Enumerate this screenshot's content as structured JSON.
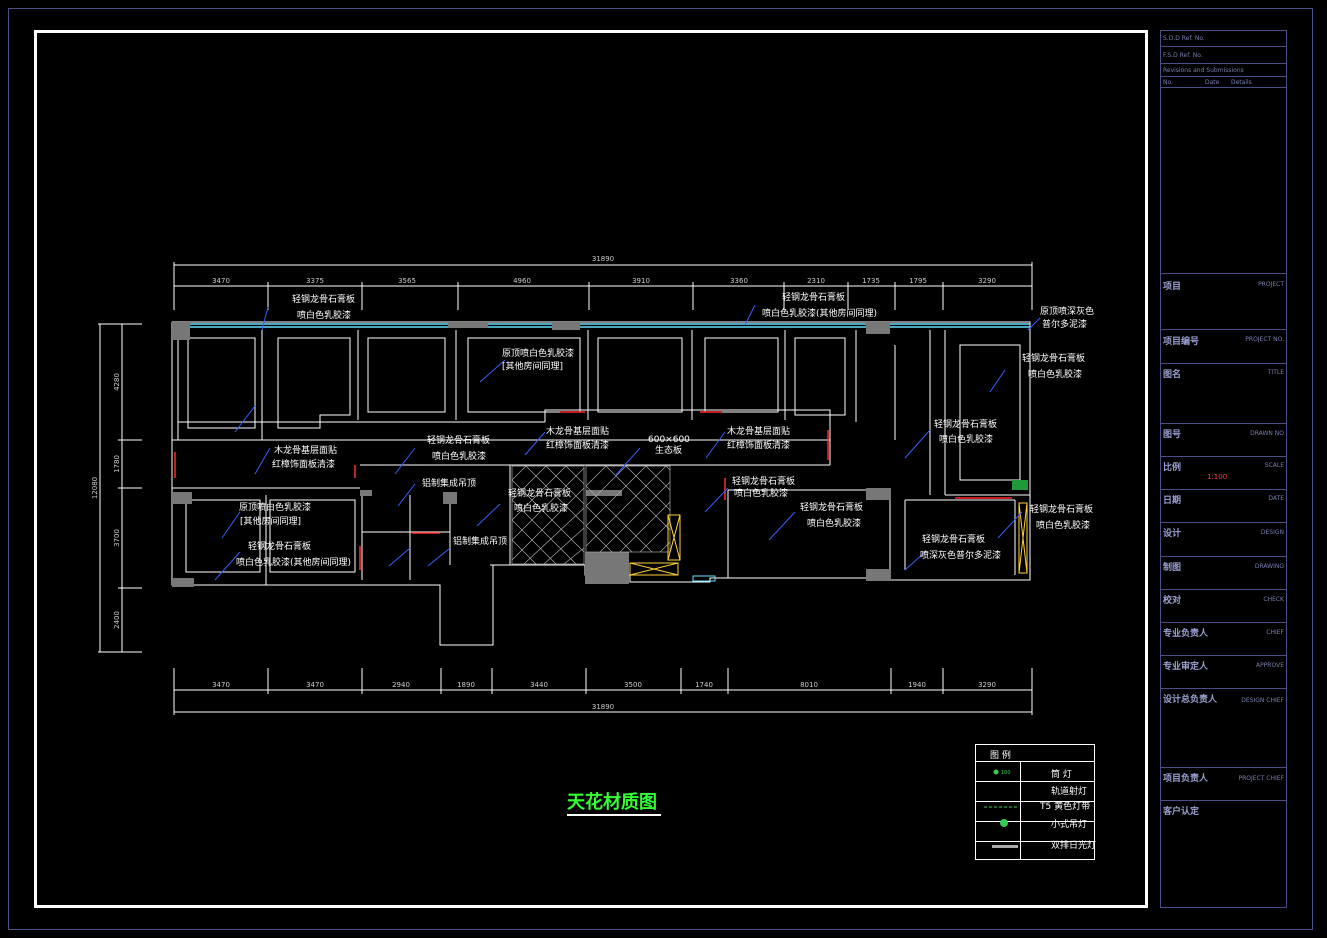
{
  "title_block": {
    "ref1": "S.D.D Ref. No.",
    "ref2": "F.S.D Ref. No.",
    "revisions": "Revisions and Submissions",
    "rev_no": "No.",
    "rev_date": "Date",
    "rev_details": "Details",
    "rows": [
      {
        "zh": "项目",
        "en": "PROJECT"
      },
      {
        "zh": "项目编号",
        "en": "PROJECT NO."
      },
      {
        "zh": "图名",
        "en": "TITLE"
      },
      {
        "zh": "图号",
        "en": "DRAWN NO"
      },
      {
        "zh": "比例",
        "en": "SCALE"
      },
      {
        "zh": "日期",
        "en": "DATE"
      },
      {
        "zh": "设计",
        "en": "DESIGN"
      },
      {
        "zh": "制图",
        "en": "DRAWING"
      },
      {
        "zh": "校对",
        "en": "CHECK"
      },
      {
        "zh": "专业负责人",
        "en": "CHIEF"
      },
      {
        "zh": "专业审定人",
        "en": "APPROVE"
      },
      {
        "zh": "设计总负责人",
        "en": "DESIGN CHIEF"
      },
      {
        "zh": "项目负责人",
        "en": "PROJECT CHIEF"
      },
      {
        "zh": "客户认定",
        "en": ""
      }
    ],
    "scale_value": "1:100"
  },
  "plan": {
    "title": "天花材质图",
    "top_total": "31890",
    "top_dims": [
      "3470",
      "3375",
      "3565",
      "4960",
      "3910",
      "3360",
      "2310",
      "1735",
      "1795",
      "3290"
    ],
    "bottom_total": "31890",
    "bottom_dims": [
      "3470",
      "3470",
      "2940",
      "1890",
      "3440",
      "3500",
      "1740",
      "8010",
      "1940",
      "3290"
    ],
    "left_total": "12080",
    "left_dims": [
      "4280",
      "1780",
      "3700",
      "2400"
    ],
    "annotations": [
      "轻钢龙骨石膏板",
      "喷白色乳胶漆",
      "轻钢龙骨石膏板",
      "喷白色乳胶漆(其他房间同理)",
      "原顶喷深灰色",
      "普尔多泥漆",
      "原顶喷白色乳胶漆",
      "[其他房间同理]",
      "轻钢龙骨石膏板",
      "喷白色乳胶漆",
      "木龙骨基层面贴",
      "红樟饰面板清漆",
      "轻钢龙骨石膏板",
      "喷白色乳胶漆",
      "木龙骨基层面贴",
      "红樟饰面板清漆",
      "600×600",
      "生态板",
      "木龙骨基层面贴",
      "红樟饰面板清漆",
      "轻钢龙骨石膏板",
      "喷白色乳胶漆",
      "铝制集成吊顶",
      "轻钢龙骨石膏板",
      "喷白色乳胶漆",
      "轻钢龙骨石膏板",
      "喷白色乳胶漆",
      "原顶喷白色乳胶漆",
      "[其他房间同理]",
      "轻钢龙骨石膏板",
      "喷白色乳胶漆(其他房间同理)",
      "铝制集成吊顶",
      "轻钢龙骨石膏板",
      "喷白色乳胶漆",
      "轻钢龙骨石膏板",
      "喷白色乳胶漆",
      "轻钢龙骨石膏板",
      "喷深灰色普尔多泥漆"
    ]
  },
  "legend": {
    "title": "图 例",
    "items": [
      {
        "icon": "downlight-icon",
        "label": "筒 灯"
      },
      {
        "icon": "track-spotlight-icon",
        "label": "轨道射灯"
      },
      {
        "icon": "led-strip-icon",
        "label": "T5 黄色灯带"
      },
      {
        "icon": "pendant-lamp-icon",
        "label": "小式吊灯"
      },
      {
        "icon": "fluorescent-icon",
        "label": "双排日光灯"
      }
    ]
  },
  "colors": {
    "line": "#ffffff",
    "annotation": "#ffffff",
    "leader": "#3a5cff",
    "accent_red": "#ff2b2b",
    "accent_cyan": "#66e0ff",
    "title_green": "#33ff33",
    "frame_blue": "#4a4f8a"
  }
}
